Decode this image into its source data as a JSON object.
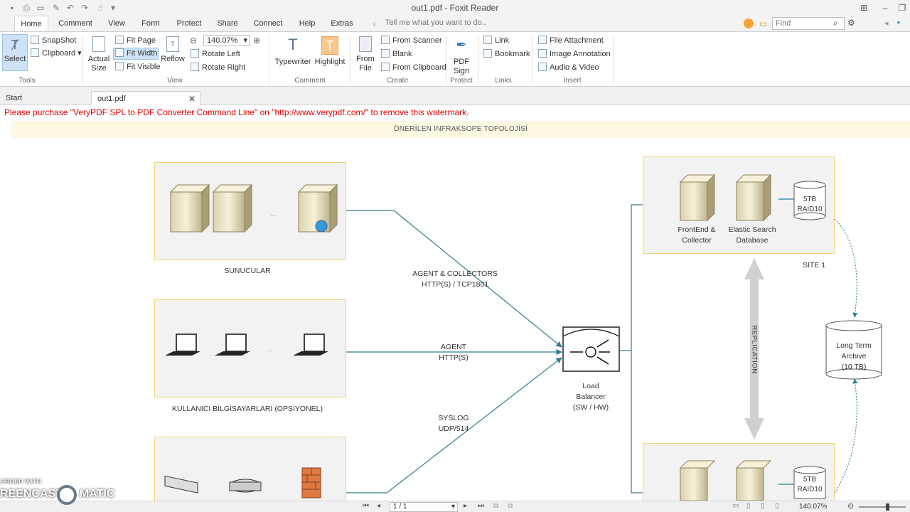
{
  "window": {
    "title": "out1.pdf - Foxit Reader"
  },
  "menu": {
    "tabs": [
      "Home",
      "Comment",
      "View",
      "Form",
      "Protect",
      "Share",
      "Connect",
      "Help",
      "Extras"
    ],
    "active": "Home",
    "tell_me": "Tell me what you want to do..",
    "find_placeholder": "Find"
  },
  "ribbon": {
    "tools": {
      "select": "Select",
      "snapshot": "SnapShot",
      "clipboard": "Clipboard",
      "group": "Tools"
    },
    "view": {
      "actual_size_1": "Actual",
      "actual_size_2": "Size",
      "fit_page": "Fit Page",
      "fit_width": "Fit Width",
      "fit_visible": "Fit Visible",
      "reflow": "Reflow",
      "zoom": "140.07%",
      "rotate_left": "Rotate Left",
      "rotate_right": "Rotate Right",
      "group": "View"
    },
    "comment": {
      "typewriter": "Typewriter",
      "highlight": "Highlight",
      "group": "Comment"
    },
    "create": {
      "from_file_1": "From",
      "from_file_2": "File",
      "from_scanner": "From Scanner",
      "blank": "Blank",
      "from_clipboard": "From Clipboard",
      "group": "Create"
    },
    "protect": {
      "pdf_sign_1": "PDF",
      "pdf_sign_2": "Sign",
      "group": "Protect"
    },
    "links": {
      "link": "Link",
      "bookmark": "Bookmark",
      "group": "Links"
    },
    "insert": {
      "file_attachment": "File Attachment",
      "image_annotation": "Image Annotation",
      "audio_video": "Audio & Video",
      "group": "Insert"
    }
  },
  "doc_tabs": {
    "start": "Start",
    "file": "out1.pdf"
  },
  "document": {
    "watermark": "Please purchase \"VeryPDF SPL to PDF Converter Command Line\" on \"http://www.verypdf.com/\" to remove this watermark.",
    "title": "ÖNERİLEN INFRAKSOPE TOPOLOJİSİ",
    "sunucular": "SUNUCULAR",
    "kullanici": "KULLANICI BİLGİSAYARLARI (OPSİYONEL)",
    "ellipsis": "...",
    "agent_collectors_1": "AGENT & COLLECTORS",
    "agent_collectors_2": "HTTP(S) / TCP1801",
    "agent_1": "AGENT",
    "agent_2": "HTTP(S)",
    "syslog_1": "SYSLOG",
    "syslog_2": "UDP/514",
    "lb_1": "Load",
    "lb_2": "Balancer",
    "lb_3": "(SW / HW)",
    "frontend_1": "FrontEnd &",
    "frontend_2": "Collector",
    "elastic_1": "Elastic Search",
    "elastic_2": "Database",
    "raid_1": "5TB",
    "raid_2": "RAID10",
    "site1": "SITE 1",
    "replication": "REPLICATION",
    "archive_1": "Long Term",
    "archive_2": "Archive",
    "archive_3": "(10 TB)"
  },
  "status": {
    "page": "1 / 1",
    "zoom": "140.07%"
  },
  "overlay": {
    "line1": "ORDED WITH",
    "line2": "REENCAST",
    "line3": "MATIC"
  },
  "colors": {
    "accent": "#f08a1c",
    "line": "#2e7d8f",
    "box_border": "#f3d479",
    "watermark": "#e00000"
  }
}
